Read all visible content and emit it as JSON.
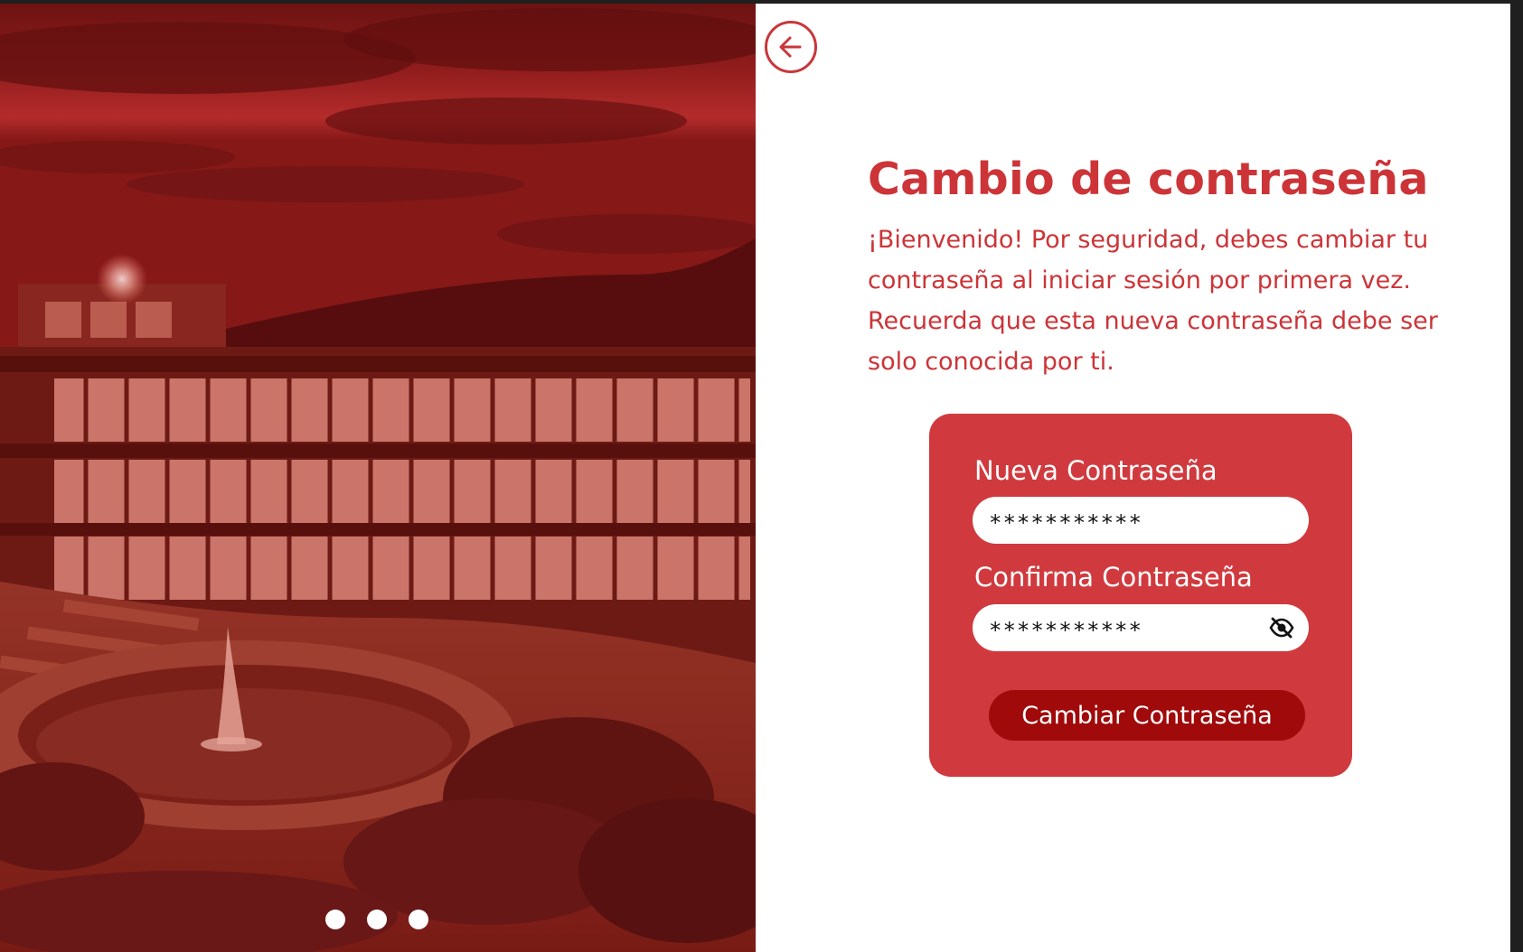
{
  "left_panel": {
    "carousel_dots": [
      "slide-1",
      "slide-2",
      "slide-3"
    ]
  },
  "back_button": {
    "icon": "arrow-left-icon"
  },
  "page": {
    "title": "Cambio de contraseña",
    "description": "¡Bienvenido! Por seguridad, debes cambiar tu contraseña al iniciar sesión por primera vez. Recuerda que esta nueva contraseña debe ser solo conocida por ti."
  },
  "form": {
    "new_password_label": "Nueva Contraseña",
    "new_password_value": "***********",
    "confirm_password_label": "Confirma Contraseña",
    "confirm_password_value": "***********",
    "visibility_icon": "eye-off-icon",
    "submit_label": "Cambiar Contraseña"
  },
  "colors": {
    "accent": "#cc3438",
    "card_background": "#d03a3e",
    "button_background": "#a00a0a",
    "image_tint": "#8b1a1a"
  }
}
